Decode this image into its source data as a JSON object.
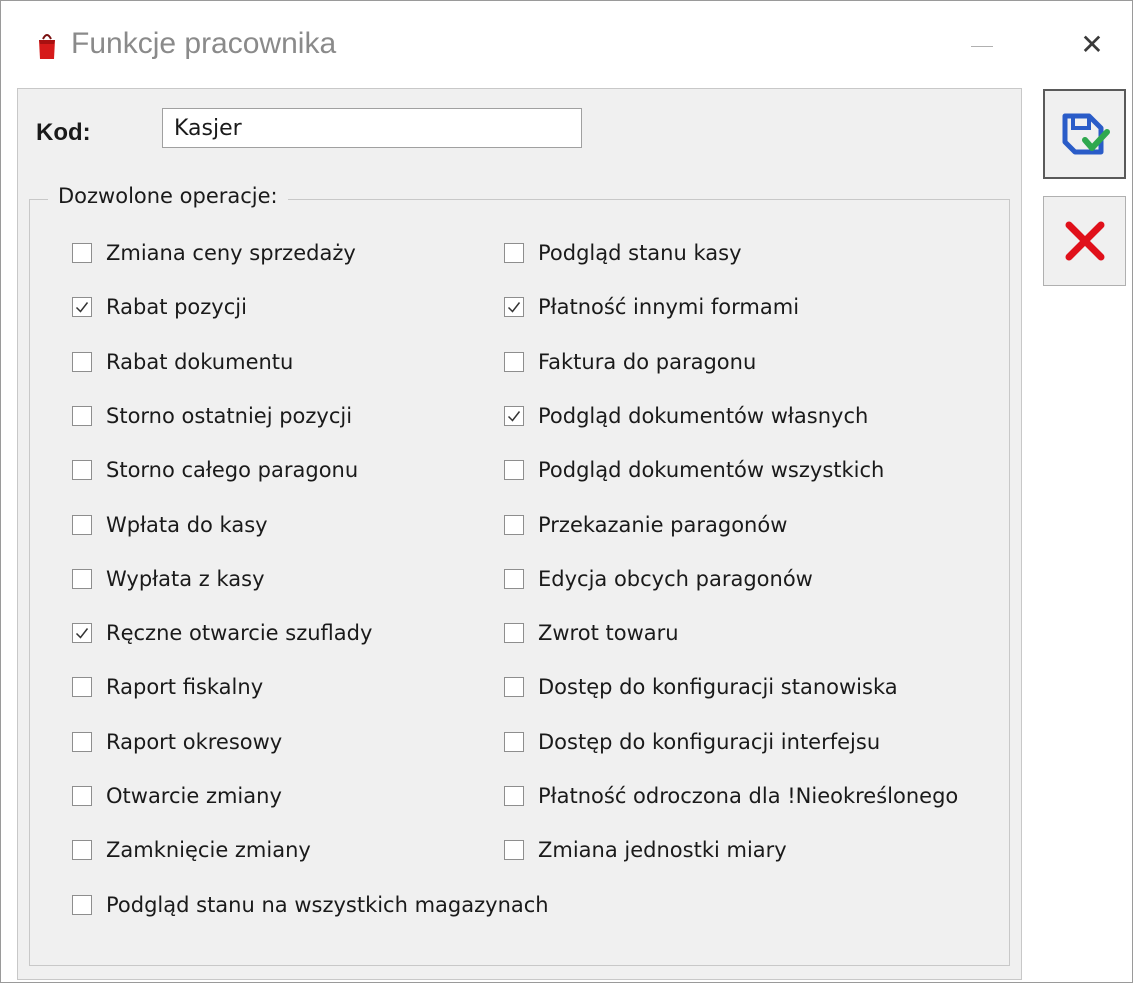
{
  "window": {
    "title": "Funkcje pracownika",
    "close_glyph": "✕"
  },
  "kod": {
    "label": "Kod:",
    "value": "Kasjer"
  },
  "group": {
    "label": "Dozwolone operacje:"
  },
  "operations_left": [
    {
      "label": "Zmiana ceny sprzedaży",
      "checked": false
    },
    {
      "label": "Rabat pozycji",
      "checked": true
    },
    {
      "label": "Rabat dokumentu",
      "checked": false
    },
    {
      "label": "Storno ostatniej pozycji",
      "checked": false
    },
    {
      "label": "Storno całego paragonu",
      "checked": false
    },
    {
      "label": "Wpłata do kasy",
      "checked": false
    },
    {
      "label": "Wypłata z kasy",
      "checked": false
    },
    {
      "label": "Ręczne otwarcie szuflady",
      "checked": true
    },
    {
      "label": "Raport fiskalny",
      "checked": false
    },
    {
      "label": "Raport okresowy",
      "checked": false
    },
    {
      "label": "Otwarcie zmiany",
      "checked": false
    },
    {
      "label": "Zamknięcie zmiany",
      "checked": false
    },
    {
      "label": "Podgląd stanu na wszystkich magazynach",
      "checked": false
    }
  ],
  "operations_right": [
    {
      "label": "Podgląd stanu kasy",
      "checked": false
    },
    {
      "label": "Płatność innymi formami",
      "checked": true
    },
    {
      "label": "Faktura do paragonu",
      "checked": false
    },
    {
      "label": "Podgląd dokumentów własnych",
      "checked": true
    },
    {
      "label": "Podgląd dokumentów wszystkich",
      "checked": false
    },
    {
      "label": "Przekazanie paragonów",
      "checked": false
    },
    {
      "label": "Edycja obcych paragonów",
      "checked": false
    },
    {
      "label": "Zwrot towaru",
      "checked": false
    },
    {
      "label": "Dostęp do konfiguracji stanowiska",
      "checked": false
    },
    {
      "label": "Dostęp do konfiguracji interfejsu",
      "checked": false
    },
    {
      "label": "Płatność odroczona dla !Nieokreślonego",
      "checked": false
    },
    {
      "label": "Zmiana jednostki miary",
      "checked": false
    }
  ],
  "colors": {
    "panel_bg": "#f0f0f0",
    "save_icon_blue": "#2a5cc8",
    "save_icon_check": "#2fa84f",
    "cancel_icon_red": "#e0101a"
  }
}
